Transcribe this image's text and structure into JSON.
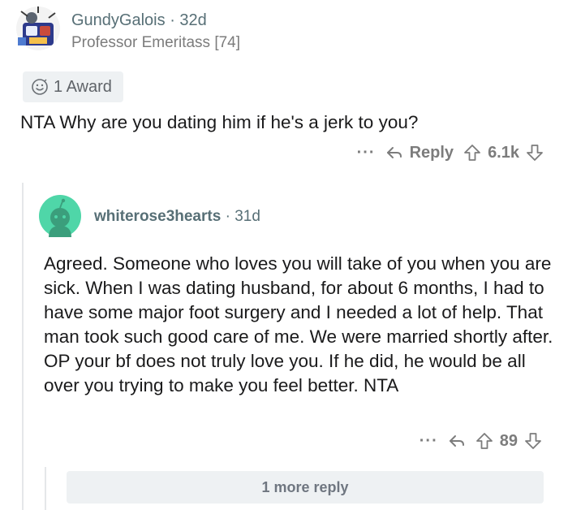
{
  "top_comment": {
    "username": "GundyGalois",
    "age": "32d",
    "separator": "·",
    "flair": "Professor Emeritass [74]",
    "award_label": "1 Award",
    "body": "NTA Why are you dating him if he's a jerk to you?",
    "actions": {
      "more": "···",
      "reply_label": "Reply",
      "score": "6.1k"
    }
  },
  "reply_comment": {
    "username": "whiterose3hearts",
    "age": "31d",
    "separator": "·",
    "body": "Agreed. Someone who loves you will take of you when you are sick. When I was dating husband, for about 6 months, I had to have some major foot surgery and I needed a lot of help. That man took such good care of me. We were married shortly after. OP your bf does not truly love you. If he did, he would be all over you trying to make you feel better. NTA",
    "actions": {
      "more": "···",
      "score": "89"
    }
  },
  "more_replies_label": "1 more reply",
  "colors": {
    "meta_gray": "#576f76",
    "action_gray": "#7c7c7c",
    "chip_bg": "#eef1f3",
    "snoo_bg": "#4fd6a8"
  },
  "icons": {
    "award": "award-smiley-icon",
    "reply": "reply-arrow-icon",
    "upvote": "upvote-arrow-icon",
    "downvote": "downvote-arrow-icon"
  }
}
